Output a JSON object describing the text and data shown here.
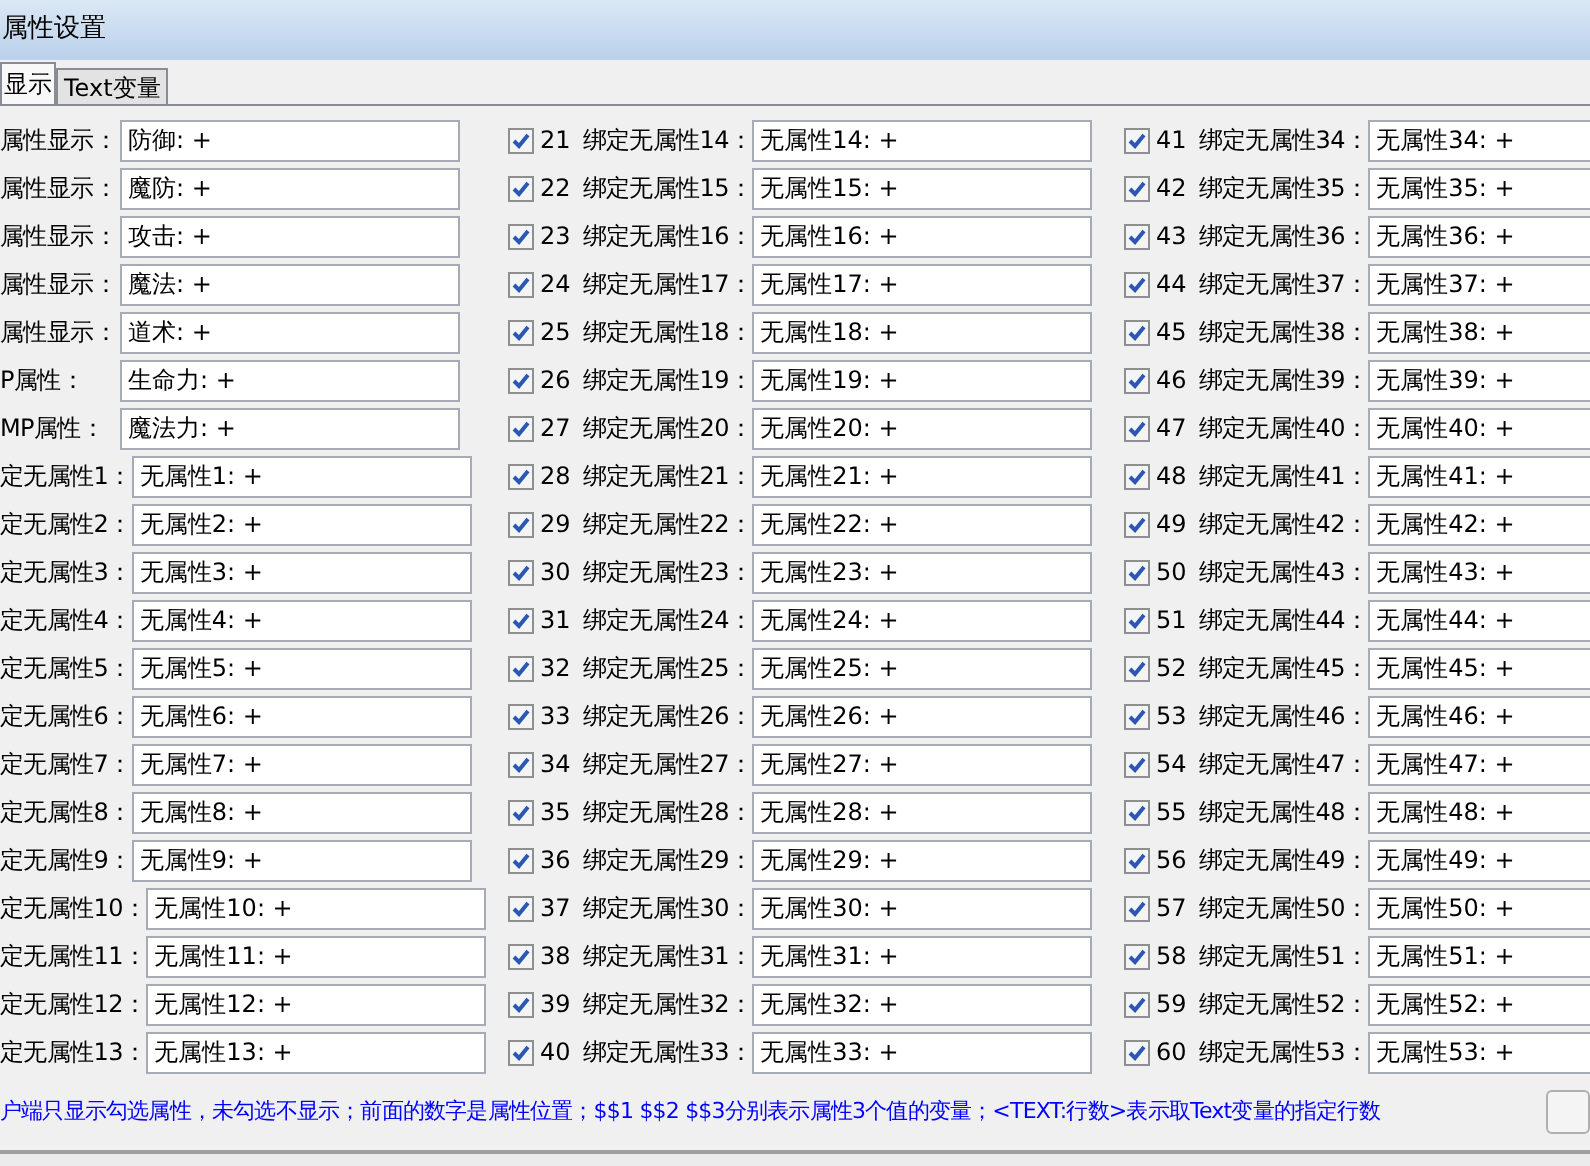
{
  "window": {
    "title": "属性设置"
  },
  "tabs": [
    {
      "label": "显示",
      "selected": true
    },
    {
      "label": "Text变量",
      "selected": false
    }
  ],
  "columns": [
    {
      "rows": [
        {
          "kind": "plain",
          "label": "属性显示：",
          "value": "防御: +"
        },
        {
          "kind": "plain",
          "label": "属性显示：",
          "value": "魔防: +"
        },
        {
          "kind": "plain",
          "label": "属性显示：",
          "value": "攻击: +"
        },
        {
          "kind": "plain",
          "label": "属性显示：",
          "value": "魔法: +"
        },
        {
          "kind": "plain",
          "label": "属性显示：",
          "value": "道术: +"
        },
        {
          "kind": "plain",
          "label": "P属性：",
          "value": "生命力: +"
        },
        {
          "kind": "plain",
          "label": "MP属性：",
          "value": "魔法力: +"
        },
        {
          "kind": "plain",
          "label": "定无属性1：",
          "value": "无属性1: +"
        },
        {
          "kind": "plain",
          "label": "定无属性2：",
          "value": "无属性2: +"
        },
        {
          "kind": "plain",
          "label": "定无属性3：",
          "value": "无属性3: +"
        },
        {
          "kind": "plain",
          "label": "定无属性4：",
          "value": "无属性4: +"
        },
        {
          "kind": "plain",
          "label": "定无属性5：",
          "value": "无属性5: +"
        },
        {
          "kind": "plain",
          "label": "定无属性6：",
          "value": "无属性6: +"
        },
        {
          "kind": "plain",
          "label": "定无属性7：",
          "value": "无属性7: +"
        },
        {
          "kind": "plain",
          "label": "定无属性8：",
          "value": "无属性8: +"
        },
        {
          "kind": "plain",
          "label": "定无属性9：",
          "value": "无属性9: +"
        },
        {
          "kind": "plain",
          "label": "定无属性10：",
          "value": "无属性10: +"
        },
        {
          "kind": "plain",
          "label": "定无属性11：",
          "value": "无属性11: +"
        },
        {
          "kind": "plain",
          "label": "定无属性12：",
          "value": "无属性12: +"
        },
        {
          "kind": "plain",
          "label": "定无属性13：",
          "value": "无属性13: +"
        }
      ]
    },
    {
      "rows": [
        {
          "kind": "checkbox",
          "checked": true,
          "number": "21",
          "label": "绑定无属性14：",
          "value": "无属性14: +"
        },
        {
          "kind": "checkbox",
          "checked": true,
          "number": "22",
          "label": "绑定无属性15：",
          "value": "无属性15: +"
        },
        {
          "kind": "checkbox",
          "checked": true,
          "number": "23",
          "label": "绑定无属性16：",
          "value": "无属性16: +"
        },
        {
          "kind": "checkbox",
          "checked": true,
          "number": "24",
          "label": "绑定无属性17：",
          "value": "无属性17: +"
        },
        {
          "kind": "checkbox",
          "checked": true,
          "number": "25",
          "label": "绑定无属性18：",
          "value": "无属性18: +"
        },
        {
          "kind": "checkbox",
          "checked": true,
          "number": "26",
          "label": "绑定无属性19：",
          "value": "无属性19: +"
        },
        {
          "kind": "checkbox",
          "checked": true,
          "number": "27",
          "label": "绑定无属性20：",
          "value": "无属性20: +"
        },
        {
          "kind": "checkbox",
          "checked": true,
          "number": "28",
          "label": "绑定无属性21：",
          "value": "无属性21: +"
        },
        {
          "kind": "checkbox",
          "checked": true,
          "number": "29",
          "label": "绑定无属性22：",
          "value": "无属性22: +"
        },
        {
          "kind": "checkbox",
          "checked": true,
          "number": "30",
          "label": "绑定无属性23：",
          "value": "无属性23: +"
        },
        {
          "kind": "checkbox",
          "checked": true,
          "number": "31",
          "label": "绑定无属性24：",
          "value": "无属性24: +"
        },
        {
          "kind": "checkbox",
          "checked": true,
          "number": "32",
          "label": "绑定无属性25：",
          "value": "无属性25: +"
        },
        {
          "kind": "checkbox",
          "checked": true,
          "number": "33",
          "label": "绑定无属性26：",
          "value": "无属性26: +"
        },
        {
          "kind": "checkbox",
          "checked": true,
          "number": "34",
          "label": "绑定无属性27：",
          "value": "无属性27: +"
        },
        {
          "kind": "checkbox",
          "checked": true,
          "number": "35",
          "label": "绑定无属性28：",
          "value": "无属性28: +"
        },
        {
          "kind": "checkbox",
          "checked": true,
          "number": "36",
          "label": "绑定无属性29：",
          "value": "无属性29: +"
        },
        {
          "kind": "checkbox",
          "checked": true,
          "number": "37",
          "label": "绑定无属性30：",
          "value": "无属性30: +"
        },
        {
          "kind": "checkbox",
          "checked": true,
          "number": "38",
          "label": "绑定无属性31：",
          "value": "无属性31: +"
        },
        {
          "kind": "checkbox",
          "checked": true,
          "number": "39",
          "label": "绑定无属性32：",
          "value": "无属性32: +"
        },
        {
          "kind": "checkbox",
          "checked": true,
          "number": "40",
          "label": "绑定无属性33：",
          "value": "无属性33: +"
        }
      ]
    },
    {
      "rows": [
        {
          "kind": "checkbox",
          "checked": true,
          "number": "41",
          "label": "绑定无属性34：",
          "value": "无属性34: +"
        },
        {
          "kind": "checkbox",
          "checked": true,
          "number": "42",
          "label": "绑定无属性35：",
          "value": "无属性35: +"
        },
        {
          "kind": "checkbox",
          "checked": true,
          "number": "43",
          "label": "绑定无属性36：",
          "value": "无属性36: +"
        },
        {
          "kind": "checkbox",
          "checked": true,
          "number": "44",
          "label": "绑定无属性37：",
          "value": "无属性37: +"
        },
        {
          "kind": "checkbox",
          "checked": true,
          "number": "45",
          "label": "绑定无属性38：",
          "value": "无属性38: +"
        },
        {
          "kind": "checkbox",
          "checked": true,
          "number": "46",
          "label": "绑定无属性39：",
          "value": "无属性39: +"
        },
        {
          "kind": "checkbox",
          "checked": true,
          "number": "47",
          "label": "绑定无属性40：",
          "value": "无属性40: +"
        },
        {
          "kind": "checkbox",
          "checked": true,
          "number": "48",
          "label": "绑定无属性41：",
          "value": "无属性41: +"
        },
        {
          "kind": "checkbox",
          "checked": true,
          "number": "49",
          "label": "绑定无属性42：",
          "value": "无属性42: +"
        },
        {
          "kind": "checkbox",
          "checked": true,
          "number": "50",
          "label": "绑定无属性43：",
          "value": "无属性43: +"
        },
        {
          "kind": "checkbox",
          "checked": true,
          "number": "51",
          "label": "绑定无属性44：",
          "value": "无属性44: +"
        },
        {
          "kind": "checkbox",
          "checked": true,
          "number": "52",
          "label": "绑定无属性45：",
          "value": "无属性45: +"
        },
        {
          "kind": "checkbox",
          "checked": true,
          "number": "53",
          "label": "绑定无属性46：",
          "value": "无属性46: +"
        },
        {
          "kind": "checkbox",
          "checked": true,
          "number": "54",
          "label": "绑定无属性47：",
          "value": "无属性47: +"
        },
        {
          "kind": "checkbox",
          "checked": true,
          "number": "55",
          "label": "绑定无属性48：",
          "value": "无属性48: +"
        },
        {
          "kind": "checkbox",
          "checked": true,
          "number": "56",
          "label": "绑定无属性49：",
          "value": "无属性49: +"
        },
        {
          "kind": "checkbox",
          "checked": true,
          "number": "57",
          "label": "绑定无属性50：",
          "value": "无属性50: +"
        },
        {
          "kind": "checkbox",
          "checked": true,
          "number": "58",
          "label": "绑定无属性51：",
          "value": "无属性51: +"
        },
        {
          "kind": "checkbox",
          "checked": true,
          "number": "59",
          "label": "绑定无属性52：",
          "value": "无属性52: +"
        },
        {
          "kind": "checkbox",
          "checked": true,
          "number": "60",
          "label": "绑定无属性53：",
          "value": "无属性53: +"
        }
      ]
    }
  ],
  "hint": "户端只显示勾选属性，未勾选不显示；前面的数字是属性位置；$$1 $$2 $$3分别表示属性3个值的变量；<TEXT:行数>表示取Text变量的指定行数"
}
